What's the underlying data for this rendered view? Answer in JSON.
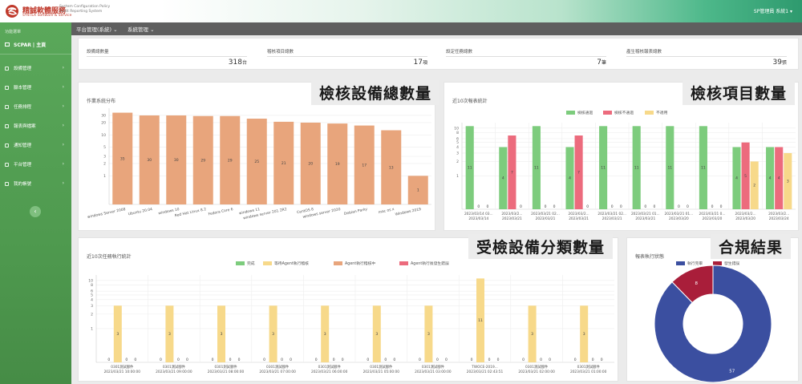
{
  "brand": {
    "name": "精誠軟體服務",
    "sub": "SYSTEX Software & Service",
    "system": "System Configuration Policy Audit Reporting System",
    "red": "#c0392b"
  },
  "user": {
    "label": "SP管理員 系統1 ▾"
  },
  "sidebar": {
    "header": "功能選單",
    "home": "SCPAR | 主頁",
    "items": [
      {
        "label": "設備管理"
      },
      {
        "label": "腳本管理"
      },
      {
        "label": "任務排程"
      },
      {
        "label": "報表與檔案"
      },
      {
        "label": "通知管理"
      },
      {
        "label": "平台管理"
      },
      {
        "label": "我的帳號"
      }
    ],
    "collapse": "‹"
  },
  "topnav": {
    "menu1": "平台管理(系統) ⌄",
    "menu2": "系統管理 ⌄"
  },
  "stats": [
    {
      "label": "設備總數量",
      "value": "318",
      "unit": "台"
    },
    {
      "label": "稽核項目總數",
      "value": "17",
      "unit": "項"
    },
    {
      "label": "設定任務總數",
      "value": "7",
      "unit": "筆"
    },
    {
      "label": "產生稽核報表總數",
      "value": "39",
      "unit": "張"
    }
  ],
  "callouts": {
    "c1": "檢核設備總數量",
    "c2": "檢核項目數量",
    "c3": "受檢設備分類數量",
    "c4": "合規結果"
  },
  "panels": {
    "os": "作業系統分布",
    "reports": "近10次報表統計",
    "tasks": "近10次任務執行統計",
    "status": "報表執行狀態"
  },
  "colors": {
    "orange": "#e8a57c",
    "green": "#7dcc7d",
    "red": "#ec6b7d",
    "yellow": "#f7d98a",
    "navy": "#3b4fa0",
    "maroon": "#a91e3a"
  },
  "chart_data": [
    {
      "type": "bar",
      "title": "作業系統分布",
      "categories": [
        "windows Server 2008",
        "Ubuntu 20.04",
        "windows 10",
        "Red Hat Linux 8.2",
        "Fedora Core 6",
        "windows 11",
        "windows server 201 2R2",
        "CentOS 8",
        "windows server 2020",
        "Debian Parky",
        "mac os x",
        "Windows 2019"
      ],
      "values": [
        35,
        30,
        30,
        29,
        29,
        25,
        21,
        20,
        19,
        17,
        13,
        1
      ],
      "labels": [
        "35",
        "30",
        "30",
        "29",
        "29",
        "25",
        "21",
        "20",
        "19",
        "17",
        "13",
        "1"
      ],
      "y_scale": "log",
      "yticks": [
        "30",
        "20",
        "10",
        "5",
        "3",
        "2",
        "1"
      ],
      "yticks_values": [
        30,
        20,
        10,
        5,
        3,
        2,
        1
      ],
      "ylim": [
        0.2,
        45
      ]
    },
    {
      "type": "bar",
      "title": "近10次報表統計",
      "legend": [
        "檢核通過",
        "檢核不通過",
        "不適用"
      ],
      "categories": [
        "2023/03/14 03...",
        "2023/03/2...",
        "2023/03/21 02...",
        "2023/03/2...",
        "2023/03/21 02...",
        "2023/03/21 01...",
        "2023/03/21 01...",
        "2023/03/21 0...",
        "2023/03/2...",
        "2023/03/2..."
      ],
      "categories_line2": [
        "2023/03/14",
        "2023/03/21",
        "2023/03/21",
        "2023/03/21",
        "2023/03/21",
        "2023/03/21",
        "2023/03/20",
        "2023/03/20",
        "2023/03/20",
        "2023/03/24"
      ],
      "series": [
        {
          "name": "檢核通過",
          "values": [
            11,
            4,
            11,
            4,
            11,
            11,
            11,
            11,
            4,
            4
          ],
          "labels": [
            "11",
            "4",
            "11",
            "4",
            "11",
            "11",
            "11",
            "11",
            "4",
            "4"
          ]
        },
        {
          "name": "檢核不通過",
          "values": [
            0,
            7,
            0,
            7,
            0,
            0,
            0,
            0,
            5,
            4
          ],
          "labels": [
            "0",
            "7",
            "0",
            "7",
            "0",
            "0",
            "0",
            "0",
            "5",
            "4"
          ]
        },
        {
          "name": "不適用",
          "values": [
            0,
            0,
            0,
            0,
            0,
            0,
            0,
            0,
            2,
            3
          ],
          "labels": [
            "0",
            "0",
            "0",
            "0",
            "0",
            "0",
            "0",
            "0",
            "2",
            "3"
          ]
        }
      ],
      "y_scale": "log",
      "yticks": [
        "10",
        "8",
        "6",
        "5",
        "4",
        "3",
        "2",
        "1"
      ],
      "yticks_values": [
        10,
        8,
        6,
        5,
        4,
        3,
        2,
        1
      ],
      "ylim": [
        0.2,
        13
      ]
    },
    {
      "type": "bar",
      "title": "近10次任務執行統計",
      "legend": [
        "完成",
        "等待Agent執行稽核",
        "Agent執行稽核中",
        "Agent執行後發生錯誤"
      ],
      "categories": [
        "0301測試腳件",
        "0301測試腳件",
        "0301測試腳件",
        "0301測試腳件",
        "0301測試腳件",
        "0301測試腳件",
        "0301測試腳件",
        "TWOCE-2019...",
        "0301測試腳件",
        "0301測試腳件"
      ],
      "categories_line2": [
        "2023/03/21 10:00:00",
        "2023/03/21 09:00:00",
        "2023/03/21 08:00:00",
        "2023/03/21 07:00:00",
        "2023/03/21 06:00:00",
        "2023/03/21 05:00:00",
        "2023/03/21 03:00:00",
        "2023/03/21 02:43:51",
        "2023/03/21 02:00:00",
        "2023/03/21 01:00:00"
      ],
      "series": [
        {
          "name": "完成",
          "values": [
            0,
            0,
            0,
            0,
            0,
            0,
            0,
            0,
            0,
            0
          ],
          "labels": [
            "0",
            "0",
            "0",
            "0",
            "0",
            "0",
            "0",
            "0",
            "0",
            "0"
          ]
        },
        {
          "name": "等待Agent執行稽核",
          "values": [
            3,
            3,
            3,
            3,
            3,
            3,
            3,
            11,
            3,
            3
          ],
          "labels": [
            "3",
            "3",
            "3",
            "3",
            "3",
            "3",
            "3",
            "11",
            "3",
            "3"
          ]
        },
        {
          "name": "Agent執行稽核中",
          "values": [
            0,
            0,
            0,
            0,
            0,
            0,
            0,
            0,
            0,
            0
          ],
          "labels": [
            "0",
            "0",
            "0",
            "0",
            "0",
            "0",
            "0",
            "0",
            "0",
            "0"
          ]
        },
        {
          "name": "Agent執行後發生錯誤",
          "values": [
            0,
            0,
            0,
            0,
            0,
            0,
            0,
            0,
            0,
            0
          ],
          "labels": [
            "0",
            "0",
            "0",
            "0",
            "0",
            "0",
            "0",
            "0",
            "0",
            "0"
          ]
        }
      ],
      "y_scale": "log",
      "yticks": [
        "10",
        "8",
        "6",
        "5",
        "4",
        "3",
        "2",
        "1"
      ],
      "yticks_values": [
        10,
        8,
        6,
        5,
        4,
        3,
        2,
        1
      ],
      "ylim": [
        0.2,
        13
      ]
    },
    {
      "type": "pie",
      "title": "報表執行狀態",
      "donut": true,
      "legend": [
        "執行完畢",
        "發生錯誤"
      ],
      "categories": [
        "執行完畢",
        "發生錯誤"
      ],
      "values": [
        57,
        8
      ],
      "labels": [
        "57",
        "8"
      ]
    }
  ]
}
